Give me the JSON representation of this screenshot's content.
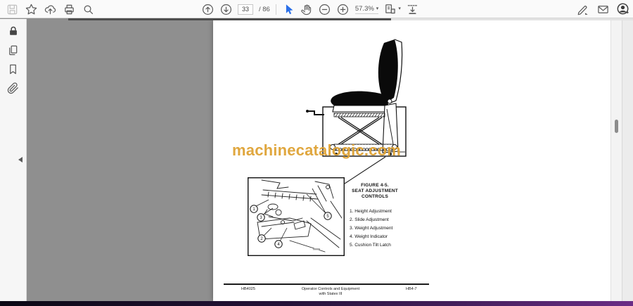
{
  "toolbar": {
    "page_current": "33",
    "page_total": "/ 86",
    "zoom_level": "57.3%",
    "caret": "▾"
  },
  "document": {
    "watermark": "machinecatalogic.com",
    "figure": {
      "title_lines": [
        "FIGURE 4-5.",
        "SEAT ADJUSTMENT",
        "CONTROLS"
      ],
      "items": [
        "1. Height Adjustment",
        "2. Slide Adjustment",
        "3. Weight Adjustment",
        "4. Weight Indicator",
        "5. Cushion Tilt Latch"
      ],
      "callouts": [
        "1",
        "2",
        "3",
        "4",
        "5"
      ]
    },
    "footer": {
      "doc_code": "HB4025",
      "section_line1": "Operator Controls and Equipment",
      "section_line2": "with Statex III",
      "page_code": "HB4-7"
    }
  },
  "colors": {
    "watermark": "#dfa335",
    "select_tool_blue": "#2a6fe8",
    "canvas_gray": "#8f8f8f",
    "toolbar_bg": "#fafafa"
  }
}
